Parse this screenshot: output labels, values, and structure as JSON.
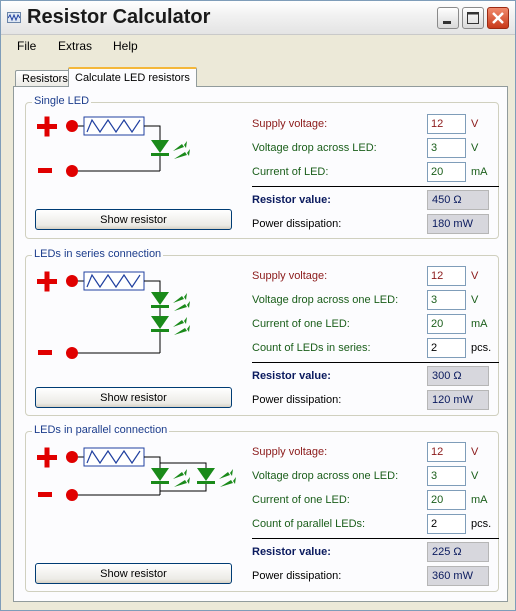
{
  "window": {
    "title": "Resistor Calculator"
  },
  "menu": [
    "File",
    "Extras",
    "Help"
  ],
  "tabs": [
    {
      "label": "Resistors",
      "active": false
    },
    {
      "label": "Calculate LED resistors",
      "active": true
    }
  ],
  "groups": [
    {
      "title": "Single LED",
      "button": "Show resistor",
      "supply_label": "Supply voltage:",
      "supply_value": "12",
      "supply_unit": "V",
      "drop_label": "Voltage drop across LED:",
      "drop_value": "3",
      "drop_unit": "V",
      "current_label": "Current of LED:",
      "current_value": "20",
      "current_unit": "mA",
      "resistor_label": "Resistor value:",
      "resistor_value": "450 Ω",
      "power_label": "Power dissipation:",
      "power_value": "180 mW"
    },
    {
      "title": "LEDs in series connection",
      "button": "Show resistor",
      "supply_label": "Supply voltage:",
      "supply_value": "12",
      "supply_unit": "V",
      "drop_label": "Voltage drop across one LED:",
      "drop_value": "3",
      "drop_unit": "V",
      "current_label": "Current of one LED:",
      "current_value": "20",
      "current_unit": "mA",
      "count_label": "Count of LEDs in series:",
      "count_value": "2",
      "count_unit": "pcs.",
      "resistor_label": "Resistor value:",
      "resistor_value": "300 Ω",
      "power_label": "Power dissipation:",
      "power_value": "120 mW"
    },
    {
      "title": "LEDs in parallel connection",
      "button": "Show resistor",
      "supply_label": "Supply voltage:",
      "supply_value": "12",
      "supply_unit": "V",
      "drop_label": "Voltage drop across one LED:",
      "drop_value": "3",
      "drop_unit": "V",
      "current_label": "Current of one LED:",
      "current_value": "20",
      "current_unit": "mA",
      "count_label": "Count of parallel LEDs:",
      "count_value": "2",
      "count_unit": "pcs.",
      "resistor_label": "Resistor value:",
      "resistor_value": "225 Ω",
      "power_label": "Power dissipation:",
      "power_value": "360 mW"
    }
  ],
  "colors": {
    "plus": "#e00000",
    "terminal": "#e00000",
    "led": "#1a8a1a",
    "wire": "#000000",
    "resistor": "#2040a0"
  },
  "icons": {
    "app": "waveform-icon",
    "minimize": "minimize-icon",
    "maximize": "maximize-icon",
    "close": "close-icon",
    "plus": "plus-terminal-icon",
    "minus": "minus-terminal-icon",
    "resistor": "resistor-icon",
    "led": "led-icon"
  }
}
